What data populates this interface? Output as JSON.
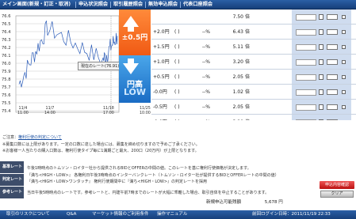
{
  "nav": {
    "items": [
      "メイン画面(新規・訂正・取消)",
      "申込状況照会",
      "取引履歴照会",
      "無効申込照会",
      "代表口座照会"
    ]
  },
  "chart": {
    "y_labels": [
      "76.6",
      "76.5",
      "76.4",
      "76.3",
      "76.2",
      "76.1",
      "76.0",
      "75.9",
      "75.8",
      "75.7",
      "75.6",
      "75.5",
      "75.4"
    ],
    "x_labels": [
      {
        "date": "11/4",
        "time": "11:00"
      },
      {
        "date": "11/7",
        "time": "14:00"
      },
      {
        "date": "11/18",
        "time": "17:00"
      },
      {
        "date": "11/25",
        "time": "10:00"
      }
    ],
    "current_rate_label": "現在のレート(76.91)",
    "promo": {
      "up_text": "±0.5円",
      "down_text1": "円高",
      "down_text2": "LOW"
    }
  },
  "chart_data": {
    "type": "line",
    "x": [
      "11/4",
      "11/7",
      "11/18",
      "11/25"
    ],
    "series": [
      {
        "values": [
          75.75,
          76.45,
          76.05,
          76.35
        ]
      }
    ]
  },
  "table": {
    "rows": [
      {
        "rate": "",
        "pct": "",
        "value": "7.50",
        "unit": "倍"
      },
      {
        "rate": "+2.0円",
        "paren": "(  )",
        "pct": "--%",
        "value": "6.43",
        "unit": "倍"
      },
      {
        "rate": "+1.5円",
        "paren": "(  )",
        "pct": "--%",
        "value": "5.11",
        "unit": "倍"
      },
      {
        "rate": "+1.0円",
        "paren": "(  )",
        "pct": "--%",
        "value": "3.20",
        "unit": "倍"
      },
      {
        "rate": "+0.5円",
        "paren": "(  )",
        "pct": "--%",
        "value": "2.05",
        "unit": "倍"
      },
      {
        "rate": "-0.0円",
        "paren": "(  )",
        "pct": "--%",
        "value": "1.02",
        "unit": "倍"
      },
      {
        "rate": "-0.5円",
        "paren": "(  )",
        "pct": "--%",
        "value": "2.05",
        "unit": "倍"
      },
      {
        "rate": "-1.0円",
        "paren": "(  )",
        "pct": "--%",
        "value": "3.20",
        "unit": "倍"
      }
    ]
  },
  "info": {
    "notice_title": "ご注意：",
    "notice_link": "権利行使の判定について",
    "notice_lines": [
      "※募集口数には上限があります。一定の口数に達した場合には、募集を締め切りますので予めご了承ください。",
      "※お客様一人当たりの購入口数は、権利行使タイプ毎に1満期ごと最大、200口（20万円）が上限となります。"
    ],
    "labels": [
      "基準レート",
      "判定レート",
      "参考レート"
    ],
    "label_texts": [
      "午後1時時点のトムソン・ロイター社から提供されるBIDとOFFERの中間の値。このレートを基に権利行使価格が決定します。",
      "『満ち<HIGH・LOW>』 各権利日午後3時時点のインターバンクレート（トムソン・ロイター社が提供するBIDとOFFERレートの中間の値）",
      "『満ち<HIGH・LOW>ワンタッチ』 権利行使期間中に『満ち<HIGH・LOW>』の判定レートを採用"
    ],
    "ref_text": "当日午後5時時点のレートです。参考レートと、円建午前7時までのレートが大幅に乖離した場合、取引自体を中止することがあります。",
    "sum_label": "新規申込可能残額",
    "sum_value": "5,678 円",
    "submit_btn": "申込内容確認",
    "clear_btn": "クリア"
  },
  "footer": {
    "items": [
      "取引のリスクについて",
      "Q&A",
      "マーケット情報のご利用条件",
      "操作マニュアル"
    ],
    "login": "前回ログイン日時：2011/11/19 22:33"
  },
  "colors": {
    "nav": "#1f4f90",
    "promo_orange": "#f46a1e",
    "promo_blue": "#2a80d4",
    "table_blue": "#cfdcef"
  }
}
